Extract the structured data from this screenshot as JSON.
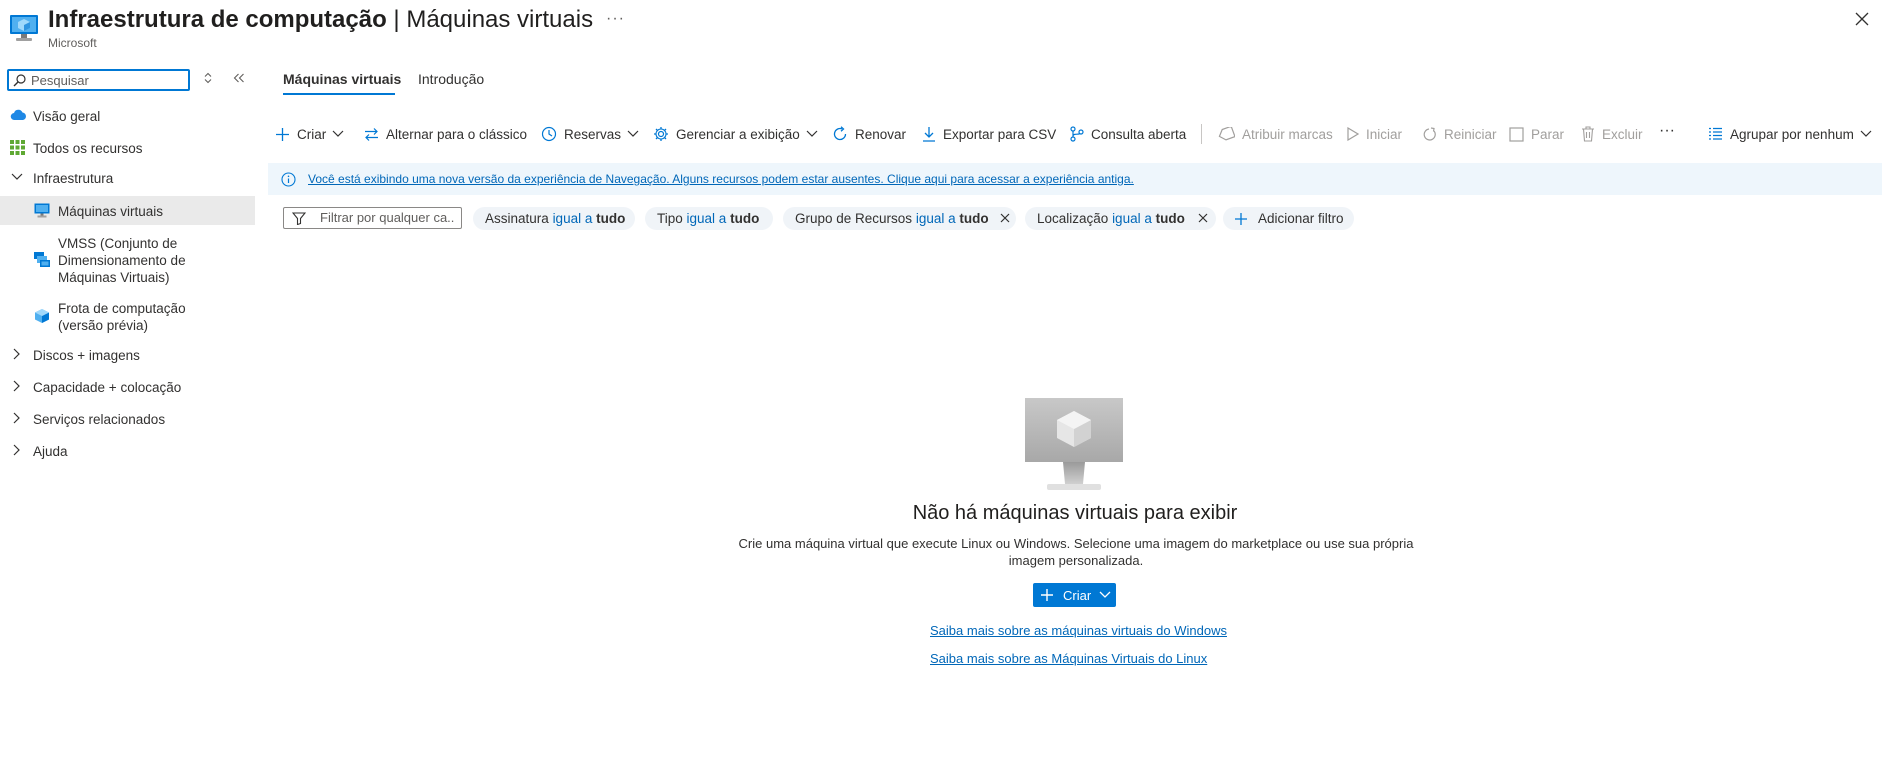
{
  "header": {
    "title_bold": "Infraestrutura de computação",
    "title_rest": " | Máquinas virtuais",
    "publisher": "Microsoft",
    "more": "···"
  },
  "sidebar": {
    "search_placeholder": "Pesquisar",
    "items": [
      {
        "label": "Visão geral",
        "icon": "cloud-icon"
      },
      {
        "label": "Todos os recursos",
        "icon": "grid-icon"
      },
      {
        "label": "Infraestrutura",
        "icon": "chevron-down-icon"
      },
      {
        "label": "Máquinas virtuais",
        "icon": "vm-icon",
        "selected": true
      },
      {
        "label": "VMSS (Conjunto de Dimensionamento de Máquinas Virtuais)",
        "icon": "vmss-icon"
      },
      {
        "label": "Frota de computação (versão prévia)",
        "icon": "compute-fleet-icon"
      },
      {
        "label": "Discos + imagens",
        "icon": "chevron-right-icon"
      },
      {
        "label": "Capacidade + colocação",
        "icon": "chevron-right-icon"
      },
      {
        "label": "Serviços relacionados",
        "icon": "chevron-right-icon"
      },
      {
        "label": "Ajuda",
        "icon": "chevron-right-icon"
      }
    ],
    "sub_lines": {
      "vmss": [
        "VMSS (Conjunto de",
        "Dimensionamento de",
        "Máquinas Virtuais)"
      ],
      "fleet": [
        "Frota de computação",
        "(versão prévia)"
      ]
    }
  },
  "tabs": [
    {
      "label": "Máquinas virtuais",
      "active": true
    },
    {
      "label": "Introdução",
      "active": false
    }
  ],
  "toolbar": {
    "create": "Criar",
    "switch_classic": "Alternar para o clássico",
    "reservations": "Reservas",
    "manage_view": "Gerenciar a exibição",
    "refresh": "Renovar",
    "export_csv": "Exportar para CSV",
    "open_query": "Consulta aberta",
    "assign_tags": "Atribuir marcas",
    "start": "Iniciar",
    "restart": "Reiniciar",
    "stop": "Parar",
    "delete": "Excluir",
    "more": "···",
    "group_by": "Agrupar por nenhum"
  },
  "info_bar": {
    "text": "Você está exibindo uma nova versão da experiência de Navegação. Alguns recursos podem estar ausentes. Clique aqui para acessar a experiência antiga."
  },
  "filters": {
    "placeholder": "Filtrar por qualquer ca...",
    "op": "igual a",
    "value": "tudo",
    "pills": [
      {
        "field": "Assinatura",
        "removable": false
      },
      {
        "field": "Tipo",
        "removable": false
      },
      {
        "field": "Grupo de Recursos",
        "removable": true
      },
      {
        "field": "Localização",
        "removable": true
      }
    ],
    "add_filter": "Adicionar filtro"
  },
  "empty_state": {
    "title": "Não há máquinas virtuais para exibir",
    "description": "Crie uma máquina virtual que execute Linux ou Windows. Selecione uma imagem do marketplace ou use sua própria imagem personalizada.",
    "create": "Criar",
    "link_windows": "Saiba mais sobre as máquinas virtuais do Windows",
    "link_linux": "Saiba mais sobre as Máquinas Virtuais do Linux"
  },
  "colors": {
    "accent": "#0078d4",
    "link": "#0067b8",
    "info_bg": "#eef6fc",
    "selected_bg": "#eaeaea",
    "pill_bg": "#f0f4f8"
  }
}
